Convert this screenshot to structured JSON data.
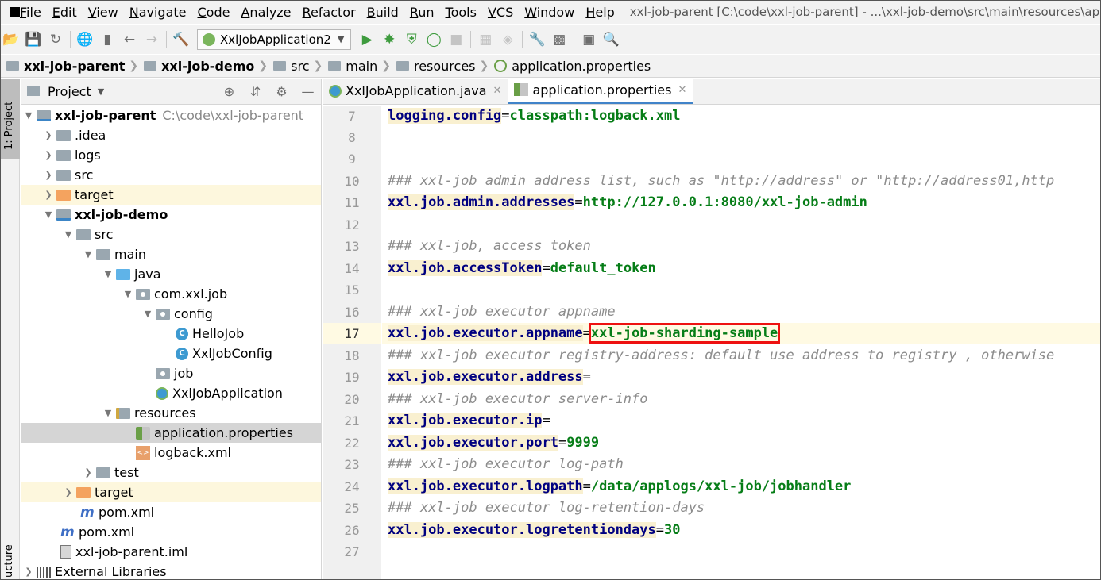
{
  "menubar": {
    "items": [
      "File",
      "Edit",
      "View",
      "Navigate",
      "Code",
      "Analyze",
      "Refactor",
      "Build",
      "Run",
      "Tools",
      "VCS",
      "Window",
      "Help"
    ],
    "window_title": "xxl-job-parent [C:\\code\\xxl-job-parent] - ...\\xxl-job-demo\\src\\main\\resources\\application.properties"
  },
  "toolbar": {
    "run_config": "XxlJobApplication2",
    "icons": [
      "open-icon",
      "save-icon",
      "sync-icon",
      "web-icon",
      "folder-icon",
      "back-icon",
      "forward-icon",
      "build-icon",
      "run-icon",
      "debug-icon",
      "coverage-icon",
      "profile-icon",
      "stop-icon",
      "vcs-icon",
      "vcs2-icon",
      "settings-icon",
      "structure-icon",
      "terminal-icon",
      "search-icon"
    ]
  },
  "breadcrumb": [
    "xxl-job-parent",
    "xxl-job-demo",
    "src",
    "main",
    "resources",
    "application.properties"
  ],
  "left_stripe": {
    "project_label": "1: Project",
    "structure_label": "ucture"
  },
  "project_panel": {
    "title": "Project",
    "tree": [
      {
        "label": "xxl-job-parent",
        "hint": "C:\\code\\xxl-job-parent"
      },
      {
        "label": ".idea"
      },
      {
        "label": "logs"
      },
      {
        "label": "src"
      },
      {
        "label": "target"
      },
      {
        "label": "xxl-job-demo"
      },
      {
        "label": "src"
      },
      {
        "label": "main"
      },
      {
        "label": "java"
      },
      {
        "label": "com.xxl.job"
      },
      {
        "label": "config"
      },
      {
        "label": "HelloJob"
      },
      {
        "label": "XxlJobConfig"
      },
      {
        "label": "job"
      },
      {
        "label": "XxlJobApplication"
      },
      {
        "label": "resources"
      },
      {
        "label": "application.properties"
      },
      {
        "label": "logback.xml"
      },
      {
        "label": "test"
      },
      {
        "label": "target"
      },
      {
        "label": "pom.xml"
      },
      {
        "label": "pom.xml"
      },
      {
        "label": "xxl-job-parent.iml"
      },
      {
        "label": "External Libraries"
      }
    ]
  },
  "editor": {
    "tabs": [
      {
        "label": "XxlJobApplication.java",
        "active": false
      },
      {
        "label": "application.properties",
        "active": true
      }
    ],
    "lines": [
      {
        "num": "7",
        "key": "logging.config",
        "value": "classpath:logback.xml"
      },
      {
        "num": "8"
      },
      {
        "num": "9"
      },
      {
        "num": "10",
        "comment": "### xxl-job admin address list, such as \"",
        "link1": "http://address",
        "mid": "\" or \"",
        "link2": "http://address01,http"
      },
      {
        "num": "11",
        "key": "xxl.job.admin.addresses",
        "value": "http://127.0.0.1:8080/xxl-job-admin"
      },
      {
        "num": "12"
      },
      {
        "num": "13",
        "comment": "### xxl-job, access token"
      },
      {
        "num": "14",
        "key": "xxl.job.accessToken",
        "value": "default_token"
      },
      {
        "num": "15"
      },
      {
        "num": "16",
        "comment": "### xxl-job executor appname"
      },
      {
        "num": "17",
        "key": "xxl.job.executor.appname",
        "value": "xxl-job-sharding-sample"
      },
      {
        "num": "18",
        "comment": "### xxl-job executor registry-address: default use address to registry , otherwise"
      },
      {
        "num": "19",
        "key": "xxl.job.executor.address",
        "value": ""
      },
      {
        "num": "20",
        "comment": "### xxl-job executor server-info"
      },
      {
        "num": "21",
        "key": "xxl.job.executor.ip",
        "value": ""
      },
      {
        "num": "22",
        "key": "xxl.job.executor.port",
        "value": "9999"
      },
      {
        "num": "23",
        "comment": "### xxl-job executor log-path"
      },
      {
        "num": "24",
        "key": "xxl.job.executor.logpath",
        "value": "/data/applogs/xxl-job/jobhandler"
      },
      {
        "num": "25",
        "comment": "### xxl-job executor log-retention-days"
      },
      {
        "num": "26",
        "key": "xxl.job.executor.logretentiondays",
        "value": "30"
      },
      {
        "num": "27"
      }
    ]
  },
  "colors": {
    "key": "#000080",
    "value": "#067d17",
    "comment": "#8c8c8c",
    "highlight_box": "#ee1111",
    "current_line": "#fffae3"
  }
}
